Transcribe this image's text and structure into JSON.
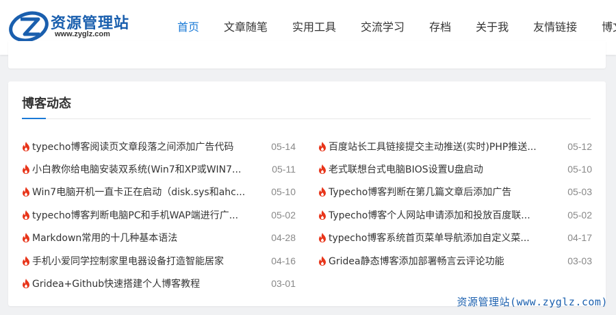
{
  "header": {
    "logo_title": "资源管理站",
    "logo_url": "www.zyglz.com",
    "nav": [
      {
        "label": "首页",
        "active": true
      },
      {
        "label": "文章随笔",
        "active": false
      },
      {
        "label": "实用工具",
        "active": false
      },
      {
        "label": "交流学习",
        "active": false
      },
      {
        "label": "存档",
        "active": false
      },
      {
        "label": "关于我",
        "active": false
      },
      {
        "label": "友情链接",
        "active": false
      },
      {
        "label": "博文",
        "active": false
      }
    ]
  },
  "section": {
    "title": "博客动态"
  },
  "posts_left": [
    {
      "title": "typecho博客阅读页文章段落之间添加广告代码",
      "date": "05-14"
    },
    {
      "title": "小白教你给电脑安装双系统(Win7和XP或WIN7...",
      "date": "05-11"
    },
    {
      "title": "Win7电脑开机一直卡正在启动（disk.sys和ahc...",
      "date": "05-10"
    },
    {
      "title": "typecho博客判断电脑PC和手机WAP端进行广...",
      "date": "05-02"
    },
    {
      "title": "Markdown常用的十几种基本语法",
      "date": "04-28"
    },
    {
      "title": "手机小爱同学控制家里电器设备打造智能居家",
      "date": "04-16"
    },
    {
      "title": "Gridea+Github快速搭建个人博客教程",
      "date": "03-01"
    }
  ],
  "posts_right": [
    {
      "title": "百度站长工具链接提交主动推送(实时)PHP推送...",
      "date": "05-12"
    },
    {
      "title": "老式联想台式电脑BIOS设置U盘启动",
      "date": "05-10"
    },
    {
      "title": "Typecho博客判断在第几篇文章后添加广告",
      "date": "05-03"
    },
    {
      "title": "Typecho博客个人网站申请添加和投放百度联...",
      "date": "05-02"
    },
    {
      "title": "typecho博客系统首页菜单导航添加自定义菜...",
      "date": "04-17"
    },
    {
      "title": "Gridea静态博客添加部署畅言云评论功能",
      "date": "03-03"
    }
  ],
  "watermark": "资源管理站(www.zyglz.com)",
  "colors": {
    "accent": "#1a7ad6",
    "fire_icon": "#e8351a",
    "logo_blue": "#1a5fae"
  }
}
